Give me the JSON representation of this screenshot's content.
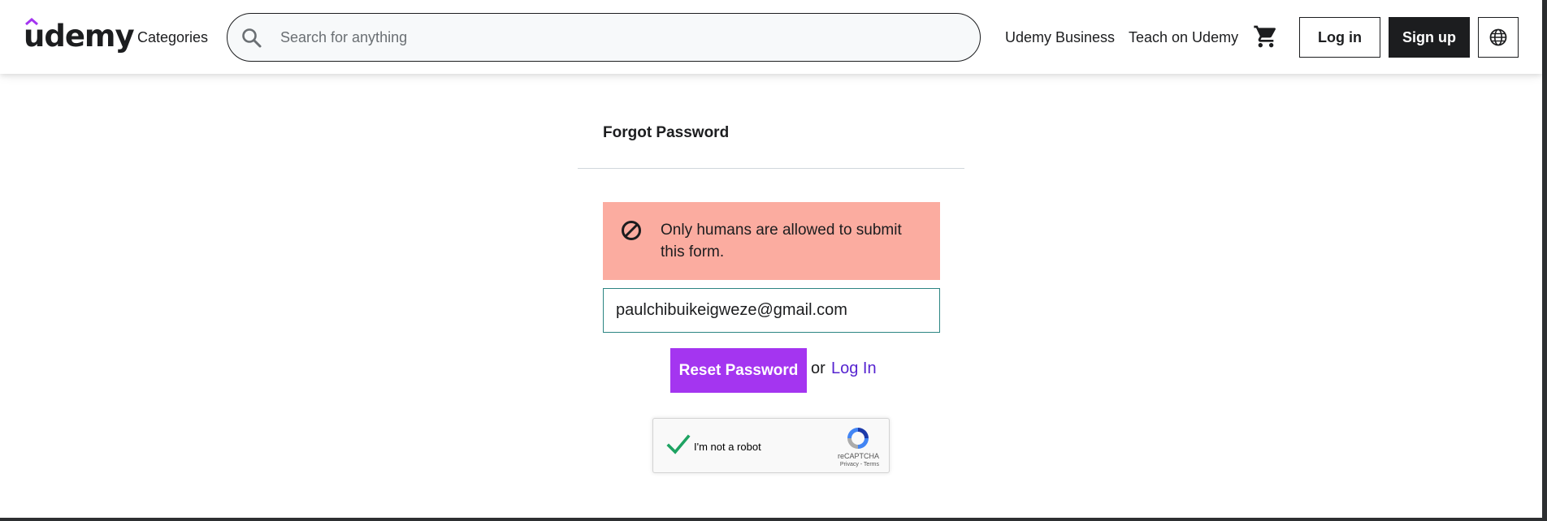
{
  "header": {
    "logo_text": "udemy",
    "categories_label": "Categories",
    "search": {
      "placeholder": "Search for anything",
      "value": ""
    },
    "udemy_business_label": "Udemy Business",
    "teach_label": "Teach on Udemy",
    "login_label": "Log in",
    "signup_label": "Sign up"
  },
  "form": {
    "title": "Forgot Password",
    "alert_text": "Only humans are allowed to submit this form.",
    "email_value": "paulchibuikeigweze@gmail.com",
    "reset_button_label": "Reset Password",
    "or_text": "or",
    "login_link_label": "Log In"
  },
  "recaptcha": {
    "label": "I'm not a robot",
    "brand": "reCAPTCHA",
    "links": "Privacy - Terms",
    "checked": true
  },
  "colors": {
    "brand_purple": "#a435f0",
    "alert_bg": "#fbaca0",
    "link_purple": "#5624d0",
    "dark": "#1c1d1f",
    "check_green": "#1ea362"
  }
}
